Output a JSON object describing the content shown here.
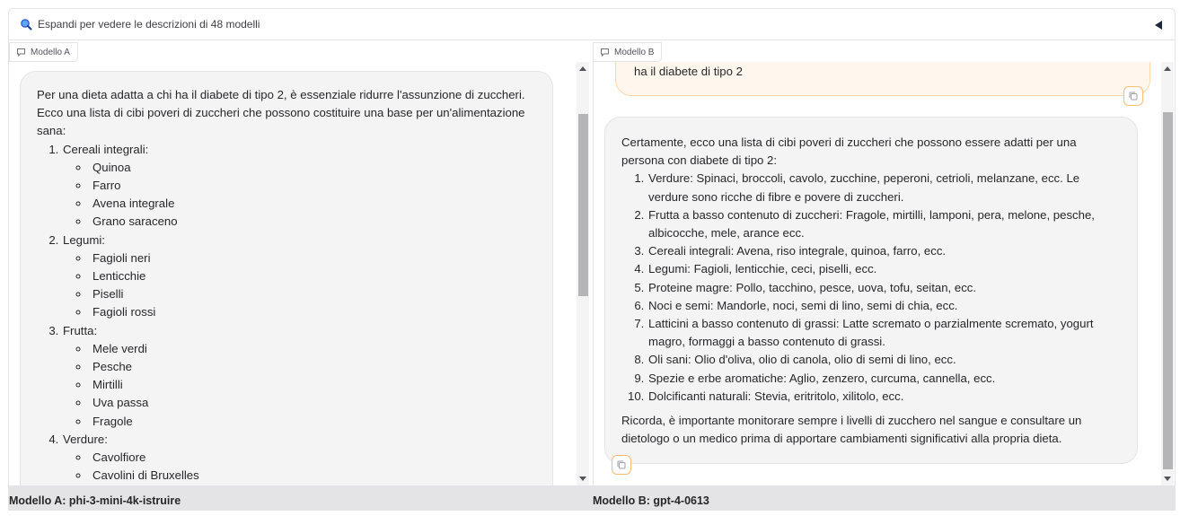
{
  "accordion": {
    "label": "Espandi per vedere le descrizioni di 48 modelli",
    "icons": {
      "lead": "magnifier-icon",
      "toggle": "triangle-left-icon"
    }
  },
  "model_a": {
    "tab_label": "Modello A",
    "intro": "Per una dieta adatta a chi ha il diabete di tipo 2, è essenziale ridurre l'assunzione di zuccheri. Ecco una lista di cibi poveri di zuccheri che possono costituire una base per un'alimentazione sana:",
    "groups": [
      {
        "title": "Cereali integrali:",
        "items": [
          "Quinoa",
          "Farro",
          "Avena integrale",
          "Grano saraceno"
        ]
      },
      {
        "title": "Legumi:",
        "items": [
          "Fagioli neri",
          "Lenticchie",
          "Piselli",
          "Fagioli rossi"
        ]
      },
      {
        "title": "Frutta:",
        "items": [
          "Mele verdi",
          "Pesche",
          "Mirtilli",
          "Uva passa",
          "Fragole"
        ]
      },
      {
        "title": "Verdure:",
        "items": [
          "Cavolfiore",
          "Cavolini di Bruxelles"
        ]
      }
    ],
    "footer": "Modello A: phi-3-mini-4k-istruire"
  },
  "model_b": {
    "tab_label": "Modello B",
    "user_text": "ha il diabete di tipo 2",
    "intro": "Certamente, ecco una lista di cibi poveri di zuccheri che possono essere adatti per una persona con diabete di tipo 2:",
    "items": [
      "Verdure: Spinaci, broccoli, cavolo, zucchine, peperoni, cetrioli, melanzane, ecc. Le verdure sono ricche di fibre e povere di zuccheri.",
      "Frutta a basso contenuto di zuccheri: Fragole, mirtilli, lamponi, pera, melone, pesche, albicocche, mele, arance ecc.",
      "Cereali integrali: Avena, riso integrale, quinoa, farro, ecc.",
      "Legumi: Fagioli, lenticchie, ceci, piselli, ecc.",
      "Proteine magre: Pollo, tacchino, pesce, uova, tofu, seitan, ecc.",
      "Noci e semi: Mandorle, noci, semi di lino, semi di chia, ecc.",
      "Latticini a basso contenuto di grassi: Latte scremato o parzialmente scremato, yogurt magro, formaggi a basso contenuto di grassi.",
      "Oli sani: Olio d'oliva, olio di canola, olio di semi di lino, ecc.",
      "Spezie e erbe aromatiche: Aglio, zenzero, curcuma, cannella, ecc.",
      "Dolcificanti naturali: Stevia, eritritolo, xilitolo, ecc."
    ],
    "closing": "Ricorda, è importante monitorare sempre i livelli di zucchero nel sangue e consultare un dietologo o un medico prima di apportare cambiamenti significativi alla propria dieta.",
    "footer": "Modello B: gpt-4-0613"
  },
  "colors": {
    "bubble_bg": "#f4f4f5",
    "user_bubble_bg": "#fff7ed",
    "accent_orange": "#fdba74",
    "footer_bg": "#e4e4e7"
  }
}
